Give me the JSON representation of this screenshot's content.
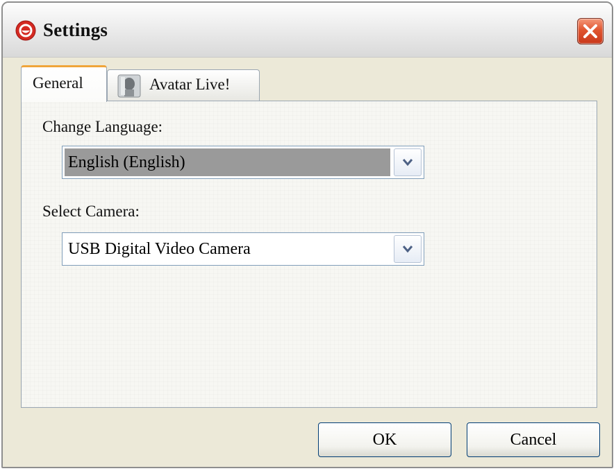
{
  "window": {
    "title": "Settings",
    "app_icon": "app-logo-icon",
    "close_icon": "close-icon"
  },
  "tabs": [
    {
      "label": "General",
      "active": true
    },
    {
      "label": "Avatar Live!",
      "icon": "avatar-icon",
      "active": false
    }
  ],
  "general": {
    "language_label": "Change Language:",
    "language_value": "English (English)",
    "camera_label": "Select Camera:",
    "camera_value": "USB Digital Video Camera"
  },
  "buttons": {
    "ok": "OK",
    "cancel": "Cancel"
  },
  "colors": {
    "window_bg": "#ece9d8",
    "tab_accent": "#f0a53a",
    "close_button": "#e0552f",
    "selected_value_bg": "#9a9a9a"
  }
}
